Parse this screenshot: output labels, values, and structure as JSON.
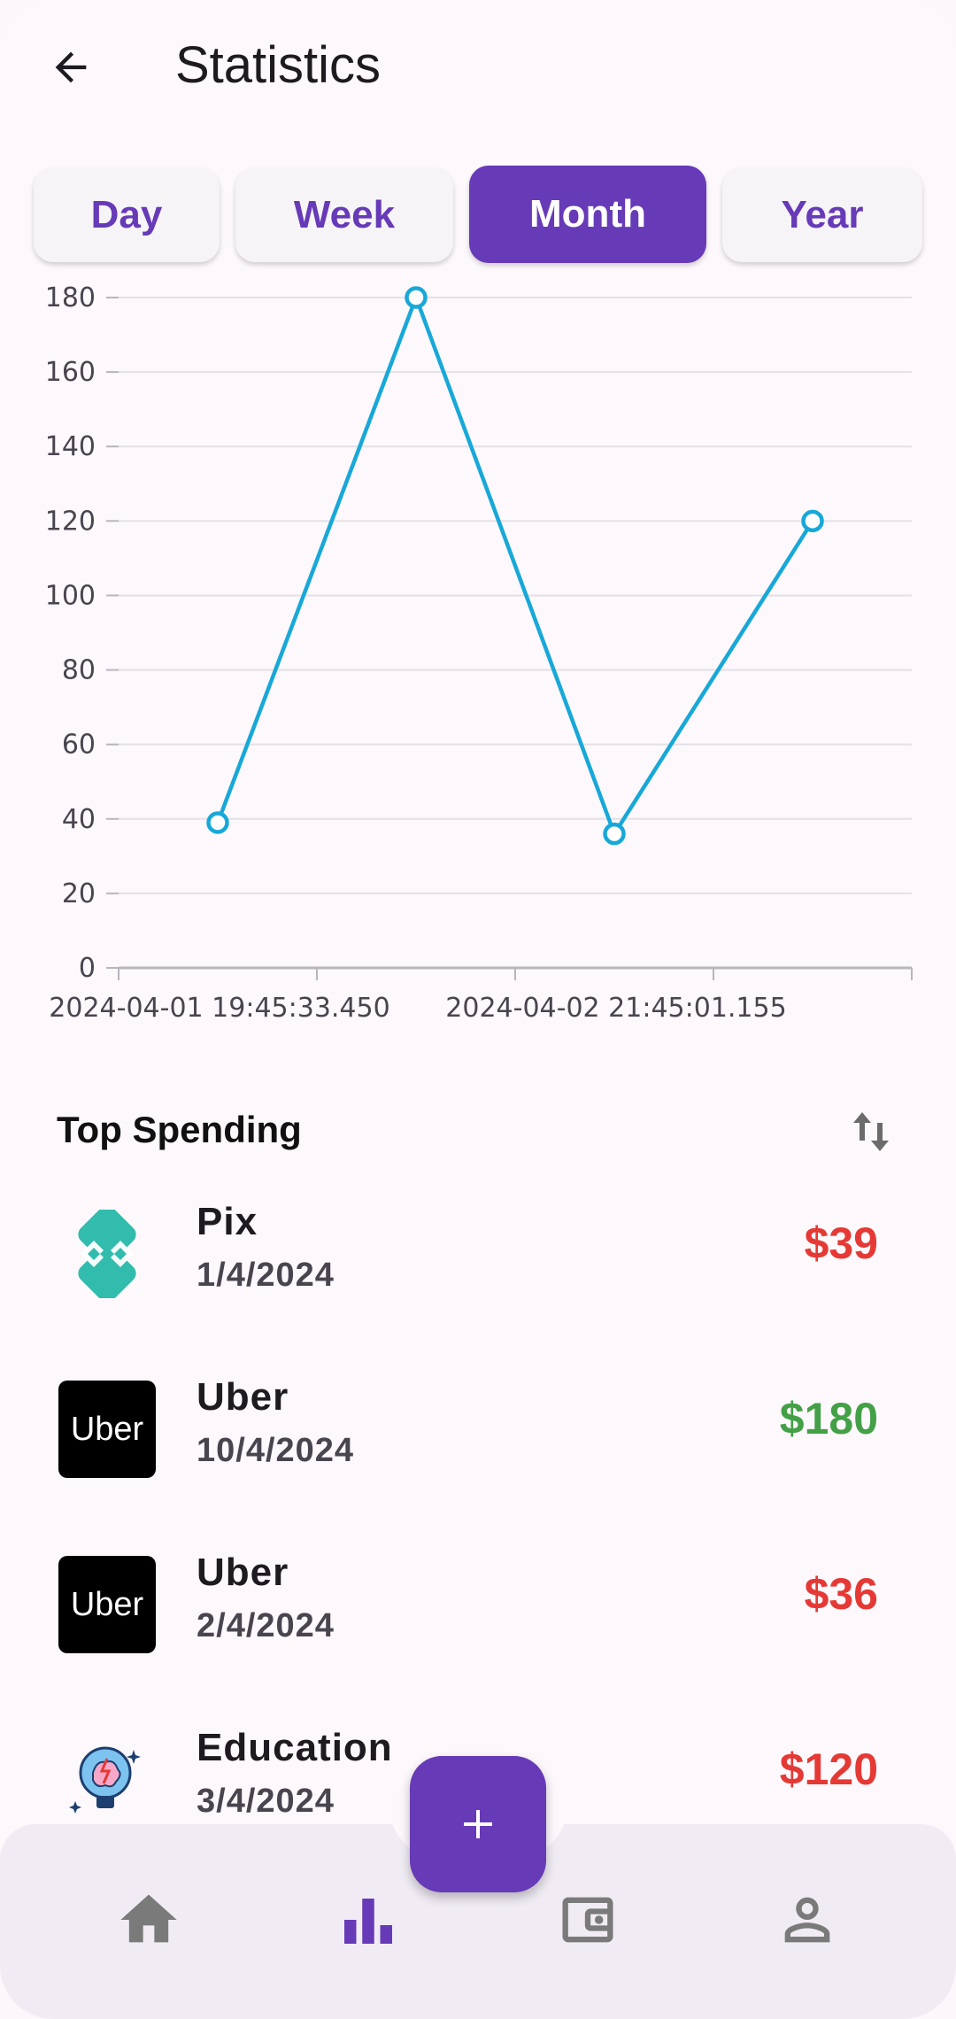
{
  "appbar": {
    "title": "Statistics",
    "back_icon": "arrow-left-icon"
  },
  "tabs": [
    {
      "label": "Day",
      "active": false
    },
    {
      "label": "Week",
      "active": false
    },
    {
      "label": "Month",
      "active": true
    },
    {
      "label": "Year",
      "active": false
    }
  ],
  "colors": {
    "accent": "#673ab7",
    "line": "#18a8d8",
    "negative": "#e53935",
    "positive": "#43a047"
  },
  "chart_data": {
    "type": "line",
    "y_ticks": [
      "0",
      "20",
      "40",
      "60",
      "80",
      "100",
      "120",
      "140",
      "160",
      "180"
    ],
    "x_tick_labels": [
      "2024-04-01 19:45:33.450",
      "2024-04-02 21:45:01.155"
    ],
    "ylim": [
      0,
      180
    ],
    "grid": true,
    "series": [
      {
        "values": [
          39,
          180,
          36,
          120
        ]
      }
    ]
  },
  "top_spending": {
    "title": "Top Spending",
    "sort_icon": "swap-vertical-icon",
    "items": [
      {
        "name": "Pix",
        "date": "1/4/2024",
        "amount": "$39",
        "type": "negative",
        "icon": "pix-icon"
      },
      {
        "name": "Uber",
        "date": "10/4/2024",
        "amount": "$180",
        "type": "positive",
        "icon": "uber-logo",
        "logo_text": "Uber"
      },
      {
        "name": "Uber",
        "date": "2/4/2024",
        "amount": "$36",
        "type": "negative",
        "icon": "uber-logo",
        "logo_text": "Uber"
      },
      {
        "name": "Education",
        "date": "3/4/2024",
        "amount": "$120",
        "type": "negative",
        "icon": "brain-bulb-icon"
      }
    ]
  },
  "bottom_nav": {
    "items": [
      {
        "icon": "home-icon",
        "active": false
      },
      {
        "icon": "bar-chart-icon",
        "active": true
      },
      {
        "icon": "wallet-icon",
        "active": false
      },
      {
        "icon": "person-icon",
        "active": false
      }
    ],
    "fab_icon": "plus-icon"
  }
}
